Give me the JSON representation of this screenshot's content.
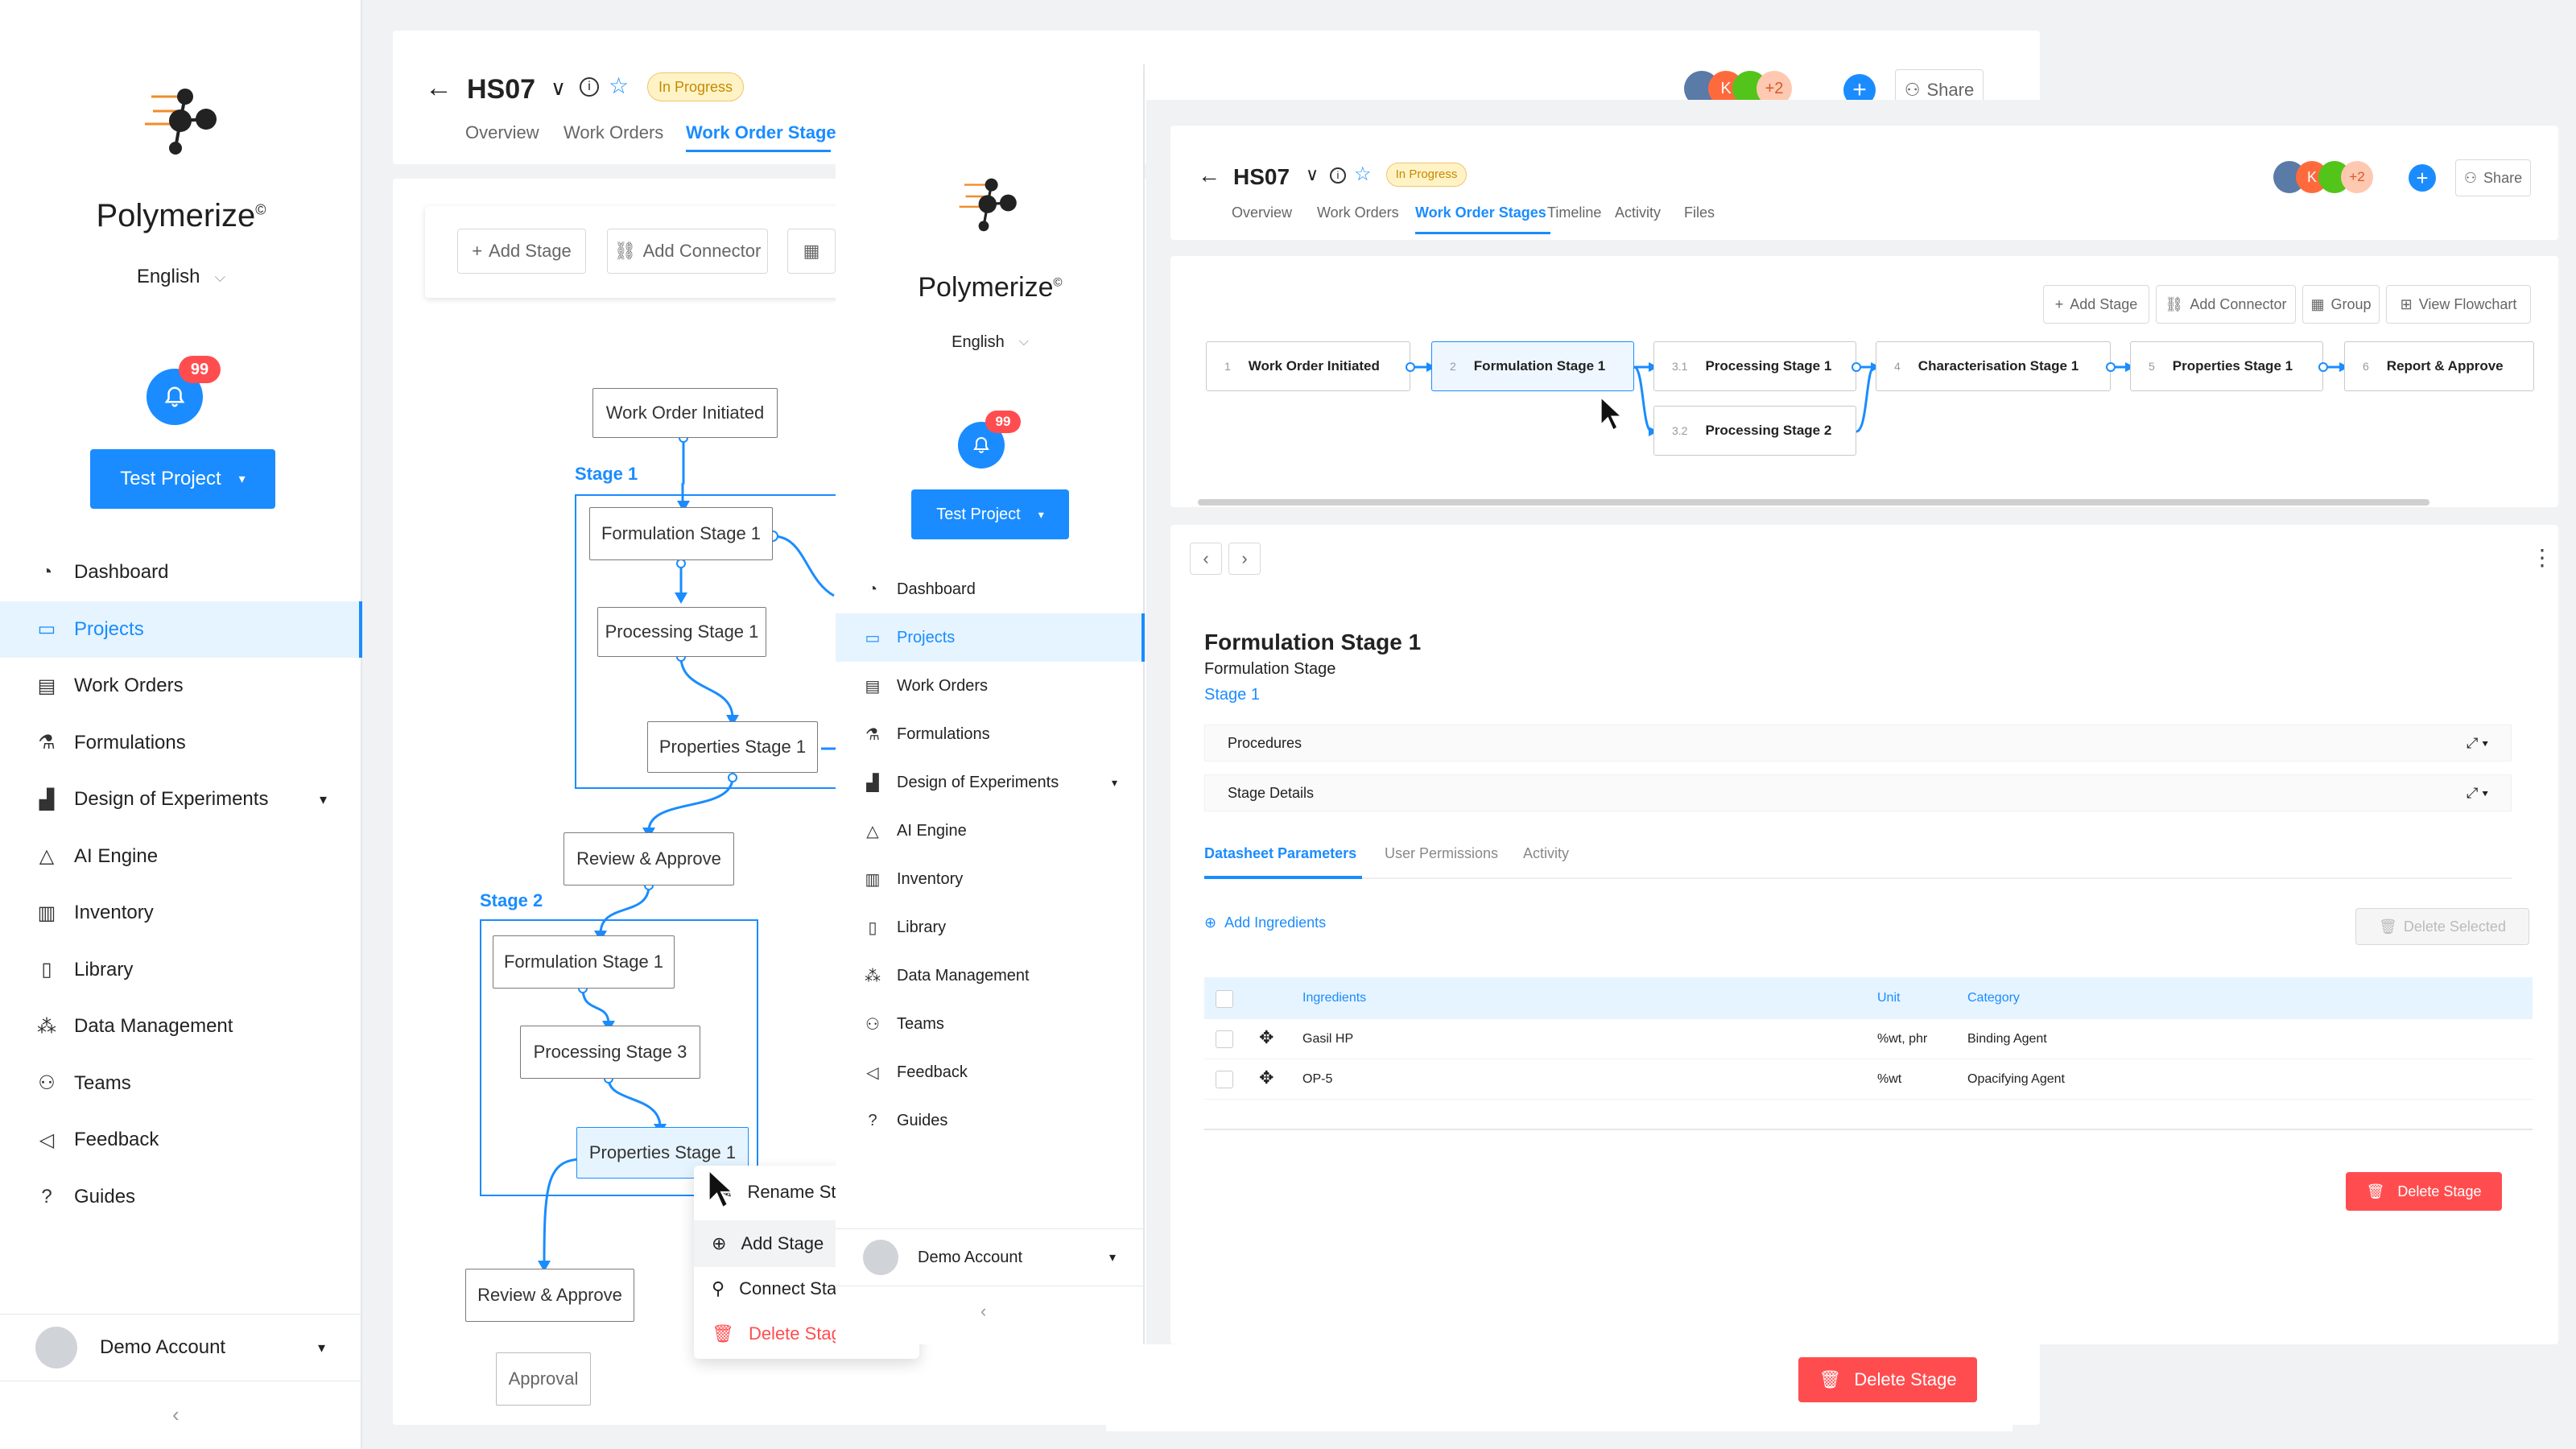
{
  "brand": {
    "name": "Polymerize",
    "reg": "©"
  },
  "language": "English",
  "notifications": {
    "count": "99"
  },
  "project_button": "Test Project",
  "nav": [
    {
      "label": "Dashboard",
      "icon": "dashboard-icon"
    },
    {
      "label": "Projects",
      "icon": "folder-icon",
      "active": true
    },
    {
      "label": "Work Orders",
      "icon": "work-order-icon"
    },
    {
      "label": "Formulations",
      "icon": "flask-icon"
    },
    {
      "label": "Design of Experiments",
      "icon": "chart-icon",
      "expand": true
    },
    {
      "label": "AI Engine",
      "icon": "ai-icon"
    },
    {
      "label": "Inventory",
      "icon": "inventory-icon"
    },
    {
      "label": "Library",
      "icon": "book-icon"
    },
    {
      "label": "Data Management",
      "icon": "data-icon"
    },
    {
      "label": "Teams",
      "icon": "teams-icon"
    },
    {
      "label": "Feedback",
      "icon": "feedback-icon"
    },
    {
      "label": "Guides",
      "icon": "help-icon"
    }
  ],
  "account": "Demo Account",
  "header": {
    "title": "HS07",
    "status": "In Progress",
    "extra_avatars": "+2",
    "share": "Share",
    "avatar_k": "K"
  },
  "tabs": [
    "Overview",
    "Work Orders",
    "Work Order Stages",
    "Timeline",
    "Activity",
    "Files"
  ],
  "back_toolbar": {
    "add_stage": "Add Stage",
    "add_connector": "Add Connector"
  },
  "back_flow": {
    "start": "Work Order Initiated",
    "stage1": "Stage 1",
    "stage2": "Stage 2",
    "s1_form": "Formulation Stage 1",
    "s1_proc": "Processing Stage 1",
    "s1_prop": "Properties Stage 1",
    "review1": "Review & Approve",
    "s2_form": "Formulation Stage 1",
    "s2_proc": "Processing Stage 3",
    "s2_prop": "Properties Stage 1",
    "review2": "Review & Approve",
    "approval": "Approval"
  },
  "context_menu": [
    "Rename Sta",
    "Add Stage",
    "Connect Sta",
    "Delete Stag"
  ],
  "front_toolbar": {
    "add_stage": "Add Stage",
    "add_connector": "Add Connector",
    "group": "Group",
    "view_flowchart": "View Flowchart"
  },
  "flow": [
    {
      "num": "1",
      "label": "Work Order Initiated"
    },
    {
      "num": "2",
      "label": "Formulation Stage 1"
    },
    {
      "num": "3.1",
      "label": "Processing Stage 1"
    },
    {
      "num": "3.2",
      "label": "Processing Stage 2"
    },
    {
      "num": "4",
      "label": "Characterisation Stage 1"
    },
    {
      "num": "5",
      "label": "Properties Stage 1"
    },
    {
      "num": "6",
      "label": "Report & Approve"
    }
  ],
  "detail": {
    "title": "Formulation Stage 1",
    "subtitle": "Formulation Stage",
    "stage_link": "Stage 1",
    "accordions": [
      "Procedures",
      "Stage Details"
    ],
    "subtabs": [
      "Datasheet Parameters",
      "User Permissions",
      "Activity"
    ],
    "add_ingredients": "Add Ingredients",
    "delete_selected": "Delete Selected",
    "columns": [
      "Ingredients",
      "Unit",
      "Category"
    ],
    "rows": [
      {
        "ingredient": "Gasil HP",
        "unit": "%wt, phr",
        "category": "Binding Agent"
      },
      {
        "ingredient": "OP-5",
        "unit": "%wt",
        "category": "Opacifying Agent"
      }
    ],
    "delete_stage": "Delete Stage"
  },
  "bottom_delete_stage": "Delete Stage",
  "colors": {
    "accent": "#1a8cff",
    "danger": "#ff4d4f",
    "status_bg": "#fff3c6"
  }
}
